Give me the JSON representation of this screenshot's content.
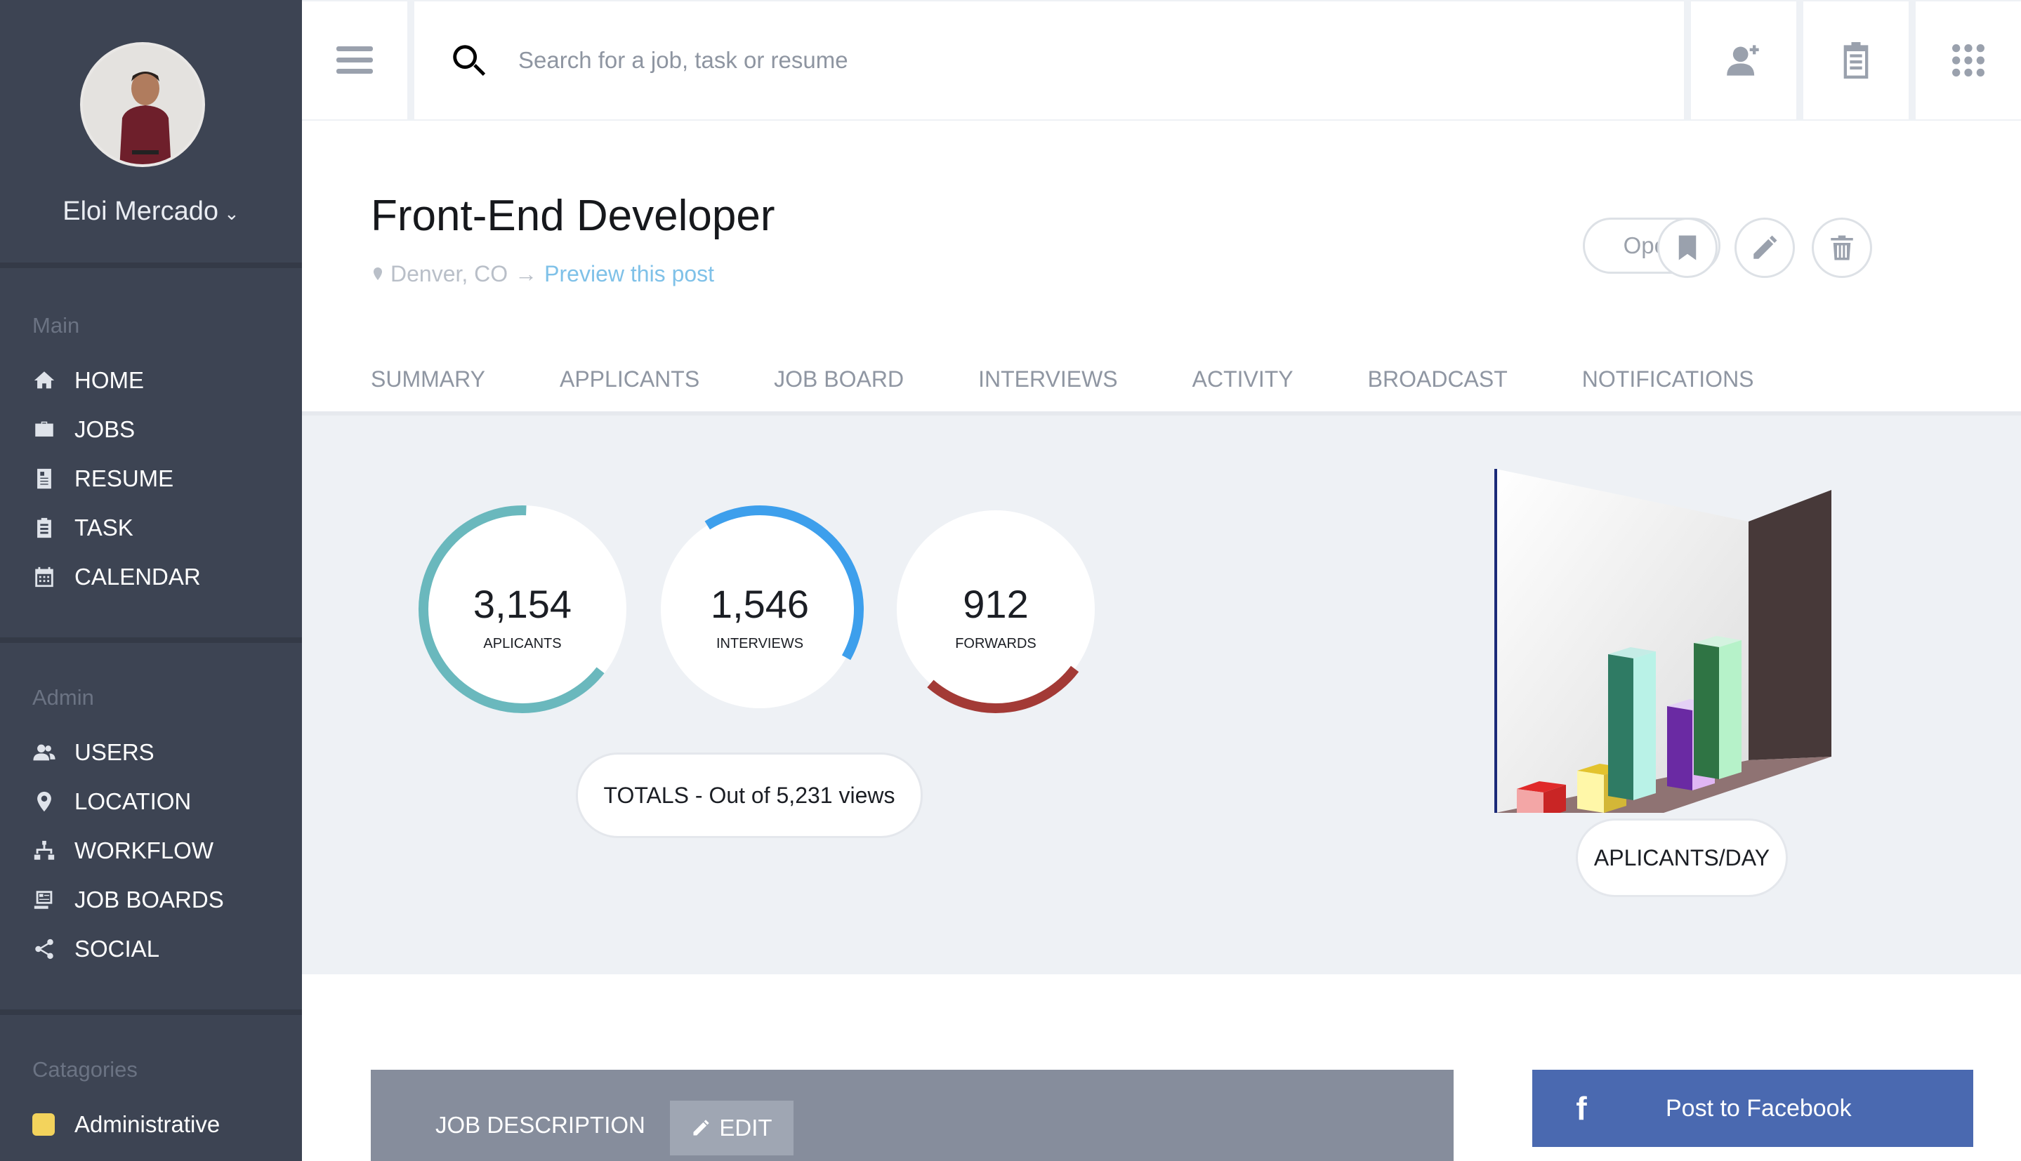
{
  "user": {
    "name": "Eloi Mercado"
  },
  "sidebar": {
    "main_heading": "Main",
    "main_items": [
      {
        "label": "HOME",
        "icon": "home-icon"
      },
      {
        "label": "JOBS",
        "icon": "briefcase-icon"
      },
      {
        "label": "RESUME",
        "icon": "resume-icon"
      },
      {
        "label": "TASK",
        "icon": "clipboard-icon"
      },
      {
        "label": "CALENDAR",
        "icon": "calendar-icon"
      }
    ],
    "admin_heading": "Admin",
    "admin_items": [
      {
        "label": "USERS",
        "icon": "users-icon"
      },
      {
        "label": "LOCATION",
        "icon": "location-pin-icon"
      },
      {
        "label": "WORKFLOW",
        "icon": "workflow-icon"
      },
      {
        "label": "JOB BOARDS",
        "icon": "job-boards-icon"
      },
      {
        "label": "SOCIAL",
        "icon": "share-icon"
      }
    ],
    "categories_heading": "Catagories",
    "categories": [
      {
        "label": "Administrative",
        "color": "#f3d35c"
      }
    ]
  },
  "search": {
    "placeholder": "Search for a job, task or resume"
  },
  "job": {
    "title": "Front-End Developer",
    "location": "Denver, CO",
    "arrow": "→",
    "preview_link": "Preview this post",
    "status": "Open"
  },
  "tabs": [
    "SUMMARY",
    "APPLICANTS",
    "JOB BOARD",
    "INTERVIEWS",
    "ACTIVITY",
    "BROADCAST",
    "NOTIFICATIONS"
  ],
  "stats": {
    "applicants": {
      "value": "3,154",
      "label": "APLICANTS",
      "color": "#6ab8bd"
    },
    "interviews": {
      "value": "1,546",
      "label": "INTERVIEWS",
      "color": "#3d9fec"
    },
    "forwards": {
      "value": "912",
      "label": "FORWARDS",
      "color": "#a33a36"
    },
    "totals": "TOTALS - Out of 5,231 views",
    "chart_label": "APLICANTS/DAY"
  },
  "description": {
    "title": "JOB DESCRIPTION",
    "edit_label": "EDIT"
  },
  "facebook": {
    "label": "Post to Facebook"
  },
  "colors": {
    "sidebar": "#3d4453",
    "accent": "#4a69b0"
  }
}
